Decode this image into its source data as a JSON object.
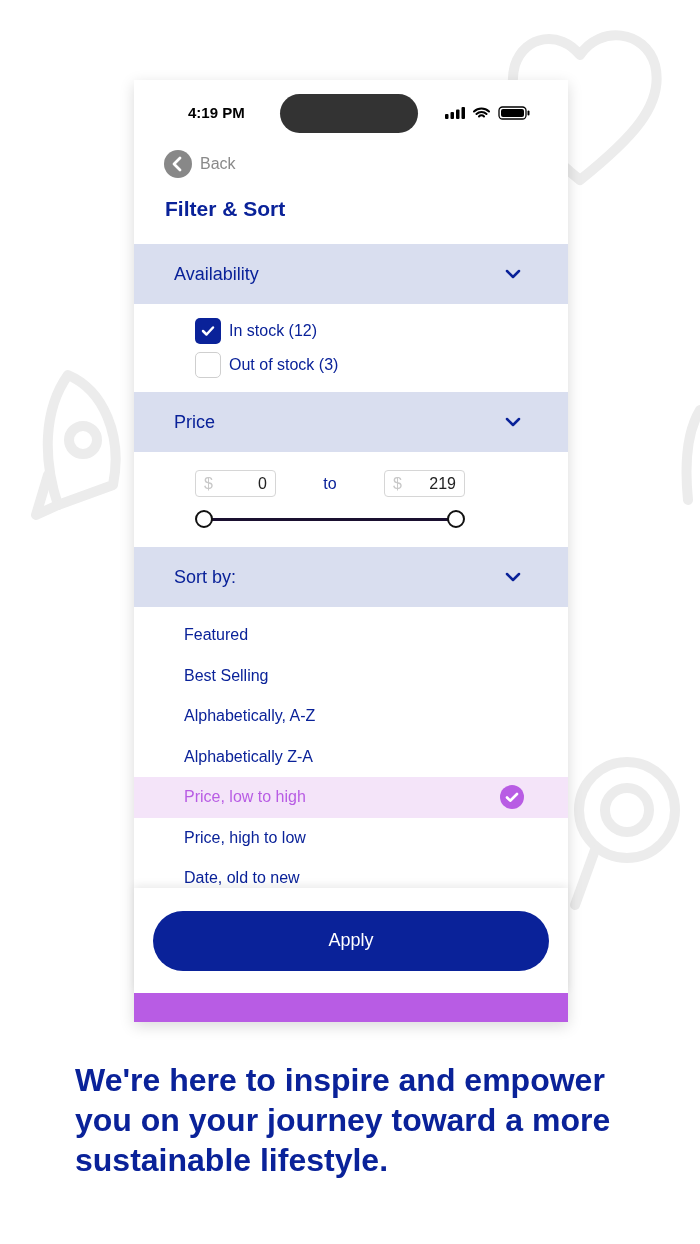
{
  "status_bar": {
    "time": "4:19 PM"
  },
  "back": {
    "label": "Back"
  },
  "title": "Filter & Sort",
  "availability": {
    "title": "Availability",
    "expanded": true,
    "options": [
      {
        "label": "In stock (12)",
        "checked": true
      },
      {
        "label": "Out of stock (3)",
        "checked": false
      }
    ]
  },
  "price": {
    "title": "Price",
    "expanded": true,
    "currency": "$",
    "min": "0",
    "separator": "to",
    "max": "219"
  },
  "sort": {
    "title": "Sort by:",
    "expanded": true,
    "options": [
      {
        "label": "Featured",
        "selected": false
      },
      {
        "label": "Best Selling",
        "selected": false
      },
      {
        "label": "Alphabetically, A-Z",
        "selected": false
      },
      {
        "label": "Alphabetically Z-A",
        "selected": false
      },
      {
        "label": "Price, low to high",
        "selected": true
      },
      {
        "label": "Price, high to low",
        "selected": false
      },
      {
        "label": "Date, old to new",
        "selected": false
      }
    ]
  },
  "apply_button": "Apply",
  "tagline": "We're here to inspire and empower you on your journey toward a more sustainable lifestyle."
}
